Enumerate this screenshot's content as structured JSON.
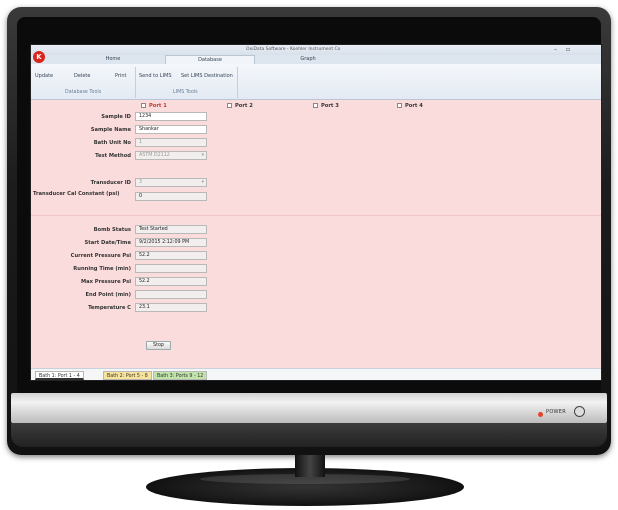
{
  "app": {
    "title": "OxiData Software - Koehler Instrument Co",
    "logo_letter": "K",
    "window_controls": {
      "minimize": "–",
      "maximize": "▫"
    }
  },
  "tabs": [
    {
      "label": "Home"
    },
    {
      "label": "Database"
    },
    {
      "label": "Graph"
    }
  ],
  "ribbon": {
    "buttons": [
      "Update",
      "Delete",
      "Print",
      "Send to LIMS",
      "Set LIMS Destination"
    ],
    "groups": [
      "Database Tools",
      "LIMS Tools"
    ]
  },
  "ports": [
    {
      "label": "Port 1"
    },
    {
      "label": "Port 2"
    },
    {
      "label": "Port 3"
    },
    {
      "label": "Port 4"
    }
  ],
  "fields": {
    "sample_id": {
      "label": "Sample ID",
      "value": "1234"
    },
    "sample_name": {
      "label": "Sample Name",
      "value": "Shankar"
    },
    "bath_unit_no": {
      "label": "Bath Unit No",
      "value": "1"
    },
    "test_method": {
      "label": "Test Method",
      "value": "ASTM D2112"
    },
    "transducer_id": {
      "label": "Transducer ID",
      "value": "3"
    },
    "transducer_cal": {
      "label": "Transducer Cal Constant (psi)",
      "value": "0"
    },
    "bomb_status": {
      "label": "Bomb Status",
      "value": "Test Started"
    },
    "start_datetime": {
      "label": "Start Date/Time",
      "value": "9/2/2015 2:12:09 PM"
    },
    "current_pressure": {
      "label": "Current Pressure  Psi",
      "value": "52.2"
    },
    "running_time": {
      "label": "Running Time (min)",
      "value": ""
    },
    "max_pressure": {
      "label": "Max Pressure  Psi",
      "value": "52.2"
    },
    "end_point": {
      "label": "End Point (min)",
      "value": ""
    },
    "temperature": {
      "label": "Temperature  C",
      "value": "23.1"
    }
  },
  "stop_label": "Stop",
  "bath_tabs": [
    {
      "label": "Bath 1: Port 1 - 4",
      "color": "#ffffff"
    },
    {
      "label": "Bath 2: Port 5 - 8",
      "color": "#f7e39a"
    },
    {
      "label": "Bath 3: Ports 9 - 12",
      "color": "#bfe3a8"
    }
  ],
  "bezel": {
    "power_label": "POWER"
  },
  "colors": {
    "form_background": "#fbdcdc",
    "accent_red": "#d9241c"
  }
}
